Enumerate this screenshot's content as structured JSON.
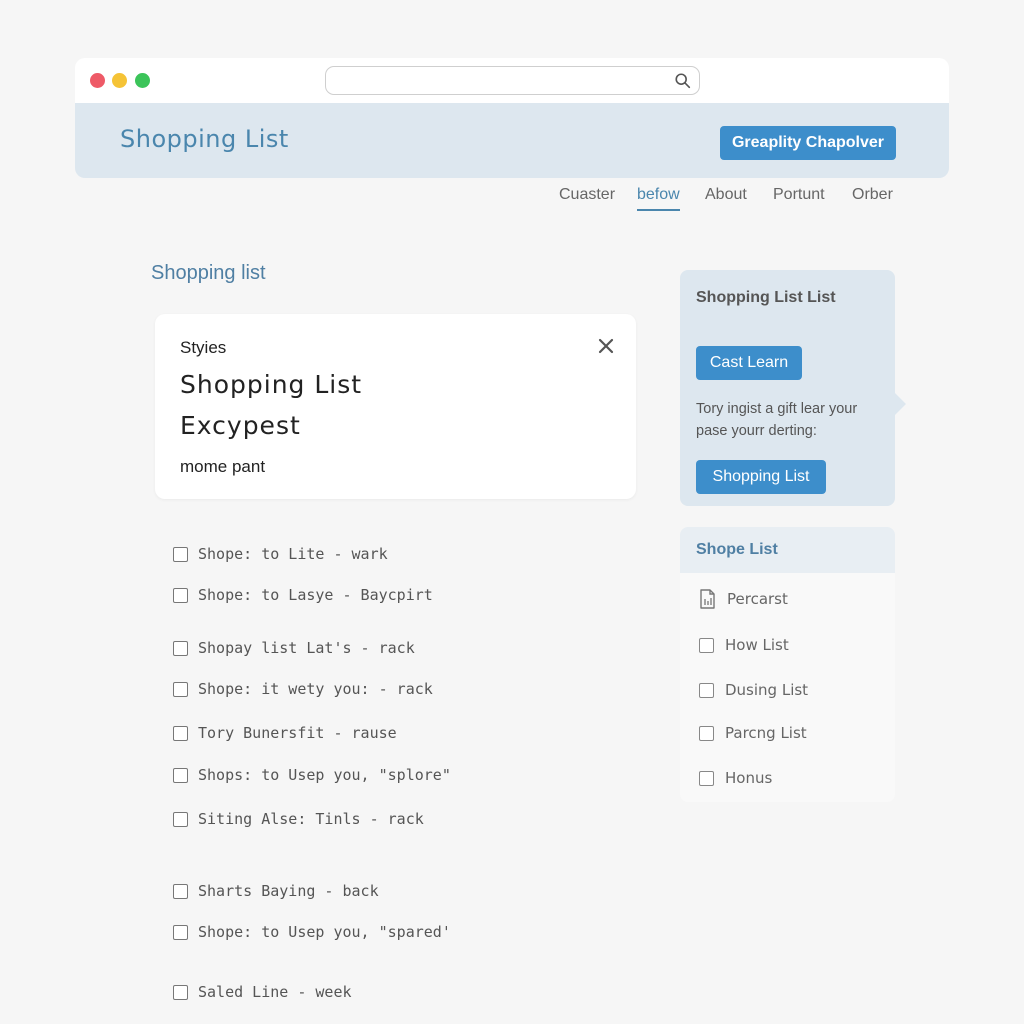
{
  "header": {
    "title": "Shopping List",
    "button_label": "Greaplity Chapolver"
  },
  "nav": {
    "items": [
      "Cuaster",
      "befow",
      "About",
      "Portunt",
      "Orber"
    ],
    "active_index": 1
  },
  "main": {
    "section_title": "Shopping list",
    "card": {
      "label": "Styies",
      "heading_1": "Shopping List",
      "heading_2": "Excypest",
      "subtext": "mome pant"
    },
    "checklist": [
      "Shope: to Lite - wark",
      "Shope: to Lasye - Baycpirt",
      "Shopay list Lat's - rack",
      "Shope: it wety you: - rack",
      "Tory Bunersfit - rause",
      "Shops: to Usep you, \"splore\"",
      "Siting Alse: Tinls - rack",
      "Sharts Baying - back",
      "Shope: to Usep you, \"spared'",
      "Saled Line - week"
    ]
  },
  "promo": {
    "title": "Shopping List List",
    "button_1": "Cast Learn",
    "text": "Tory ingist a gift lear your pase yourr derting:",
    "button_2": "Shopping List"
  },
  "side_list": {
    "header": "Shope List",
    "items": [
      "Percarst",
      "How List",
      "Dusing List",
      "Parcng List",
      "Honus"
    ]
  },
  "colors": {
    "accent": "#3d8ecb",
    "title_blue": "#4a86ad",
    "header_band": "#dde7ef",
    "dot_red": "#ee5a67",
    "dot_yellow": "#f5c336",
    "dot_green": "#3cc45a"
  }
}
